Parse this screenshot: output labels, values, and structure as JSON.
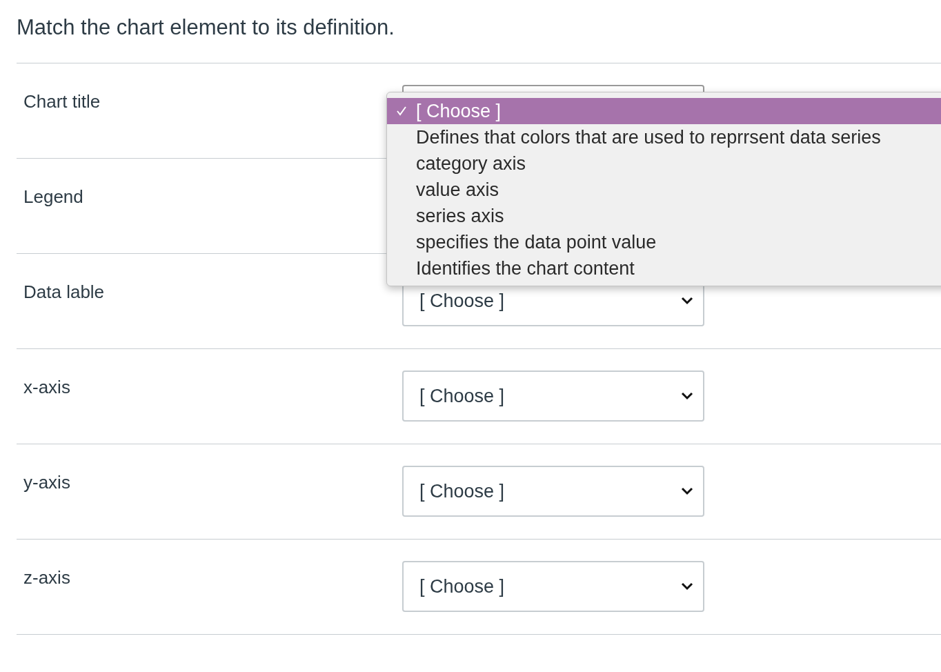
{
  "question": "Match the chart element to its definition.",
  "rows": [
    {
      "label": "Chart title",
      "dropdown_open": true,
      "options": [
        {
          "label": "[ Choose ]",
          "selected": true
        },
        {
          "label": "Defines that colors that are used to reprrsent data series",
          "selected": false
        },
        {
          "label": "category axis",
          "selected": false
        },
        {
          "label": "value axis",
          "selected": false
        },
        {
          "label": "series axis",
          "selected": false
        },
        {
          "label": "specifies the data point value",
          "selected": false
        },
        {
          "label": "Identifies the chart content",
          "selected": false
        }
      ]
    },
    {
      "label": "Legend",
      "dropdown_open": false
    },
    {
      "label": "Data lable",
      "dropdown_open": false,
      "value": "[ Choose ]"
    },
    {
      "label": "x-axis",
      "dropdown_open": false,
      "value": "[ Choose ]"
    },
    {
      "label": "y-axis",
      "dropdown_open": false,
      "value": "[ Choose ]"
    },
    {
      "label": "z-axis",
      "dropdown_open": false,
      "value": "[ Choose ]"
    }
  ]
}
